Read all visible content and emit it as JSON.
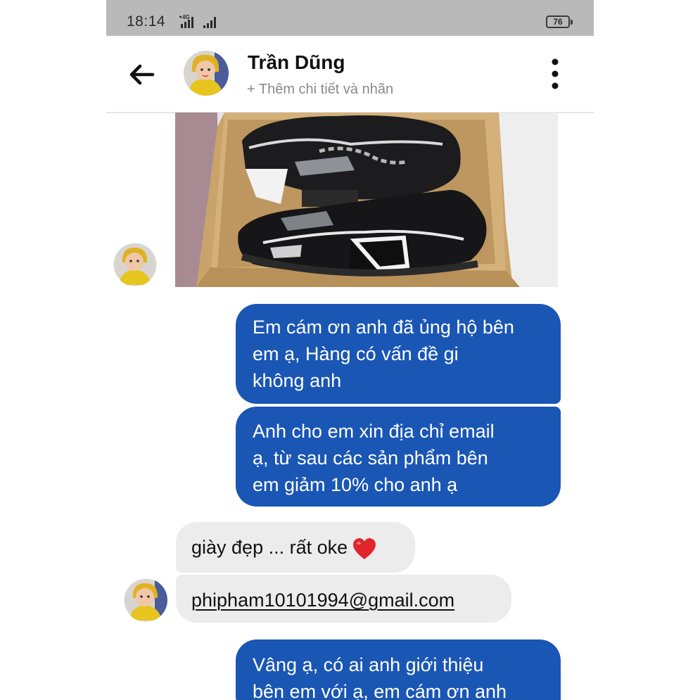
{
  "status_bar": {
    "time": "18:14",
    "network": "4G",
    "battery": "76"
  },
  "header": {
    "contact_name": "Trần Dũng",
    "subtitle": "+ Thêm chi tiết và nhãn"
  },
  "messages": [
    {
      "type": "image",
      "from": "contact",
      "icon": "shoe-photo"
    },
    {
      "type": "text",
      "from": "me",
      "lines": [
        "Em cám ơn anh đã ủng hộ bên",
        "em ạ, Hàng có vấn đề gi",
        "không anh"
      ]
    },
    {
      "type": "text",
      "from": "me",
      "lines": [
        "Anh cho em xin địa chỉ email",
        "ạ, từ sau các sản phẩm bên",
        "em giảm 10% cho anh ạ"
      ]
    },
    {
      "type": "text",
      "from": "contact",
      "text": "giày đẹp ... rất oke",
      "emoji": "heart-icon"
    },
    {
      "type": "link",
      "from": "contact",
      "text": "phipham10101994@gmail.com"
    },
    {
      "type": "text",
      "from": "me",
      "lines": [
        "Vâng ạ, có ai anh giới thiệu",
        "bên em với ạ, em cám ơn anh"
      ]
    }
  ],
  "colors": {
    "status_bar_bg": "#b9b9b9",
    "outgoing_bubble": "#1a56b4",
    "incoming_bubble": "#ececec",
    "heart": "#e0262b"
  }
}
